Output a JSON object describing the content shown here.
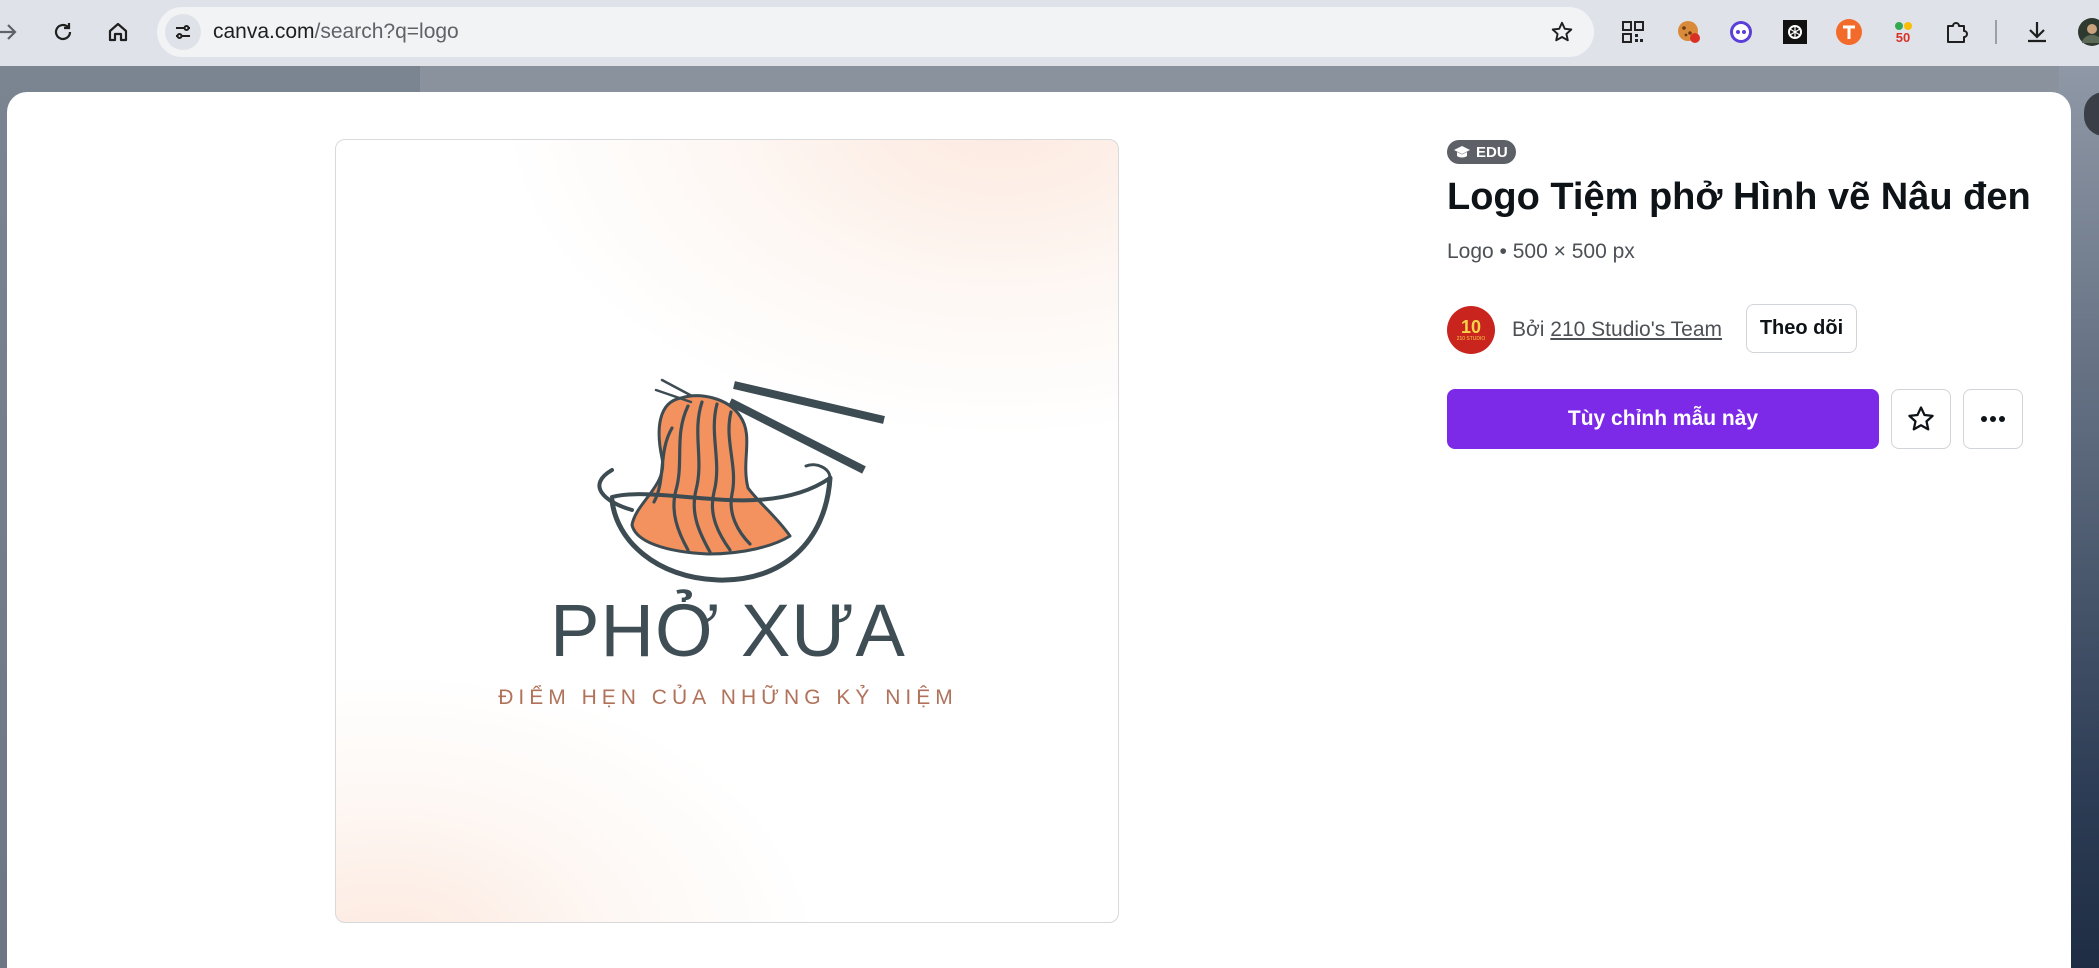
{
  "browser": {
    "url_host": "canva.com",
    "url_path": "/search?q=logo",
    "icons": {
      "forward": "arrow-right-icon",
      "reload": "reload-icon",
      "home": "home-icon",
      "site_info": "tune-icon",
      "bookmark": "star-outline-icon",
      "downloads": "download-icon",
      "extensions": "puzzle-icon"
    },
    "extensions": [
      "qr-code-icon",
      "cookie-icon",
      "robot-face-icon",
      "chatgpt-icon",
      "translate-t-icon",
      "50-percent-icon",
      "puzzle-icon"
    ]
  },
  "template": {
    "badge": "EDU",
    "badge_icon": "graduation-cap-icon",
    "title": "Logo Tiệm phở Hình vẽ Nâu đen",
    "meta": "Logo • 500 × 500 px",
    "author": {
      "prefix": "Bởi",
      "name": "210 Studio's Team",
      "avatar_text": "10",
      "avatar_subtext": "210 STUDIO"
    },
    "follow_label": "Theo dõi",
    "customize_label": "Tùy chỉnh mẫu này",
    "favorite_icon": "star-outline-icon",
    "more_icon": "more-horizontal-icon"
  },
  "preview": {
    "brand_name": "PHỞ XƯA",
    "tagline": "ĐIỂM HẸN CỦA NHỮNG KỶ NIỆM",
    "illustration": "noodle-bowl-chopsticks-icon",
    "colors": {
      "bowl_stroke": "#3d4c53",
      "noodles": "#f3925f",
      "tagline": "#b0725a"
    }
  },
  "colors": {
    "accent": "#7d2ae8",
    "title": "#0e1318",
    "edu_badge": "#5d6066"
  }
}
